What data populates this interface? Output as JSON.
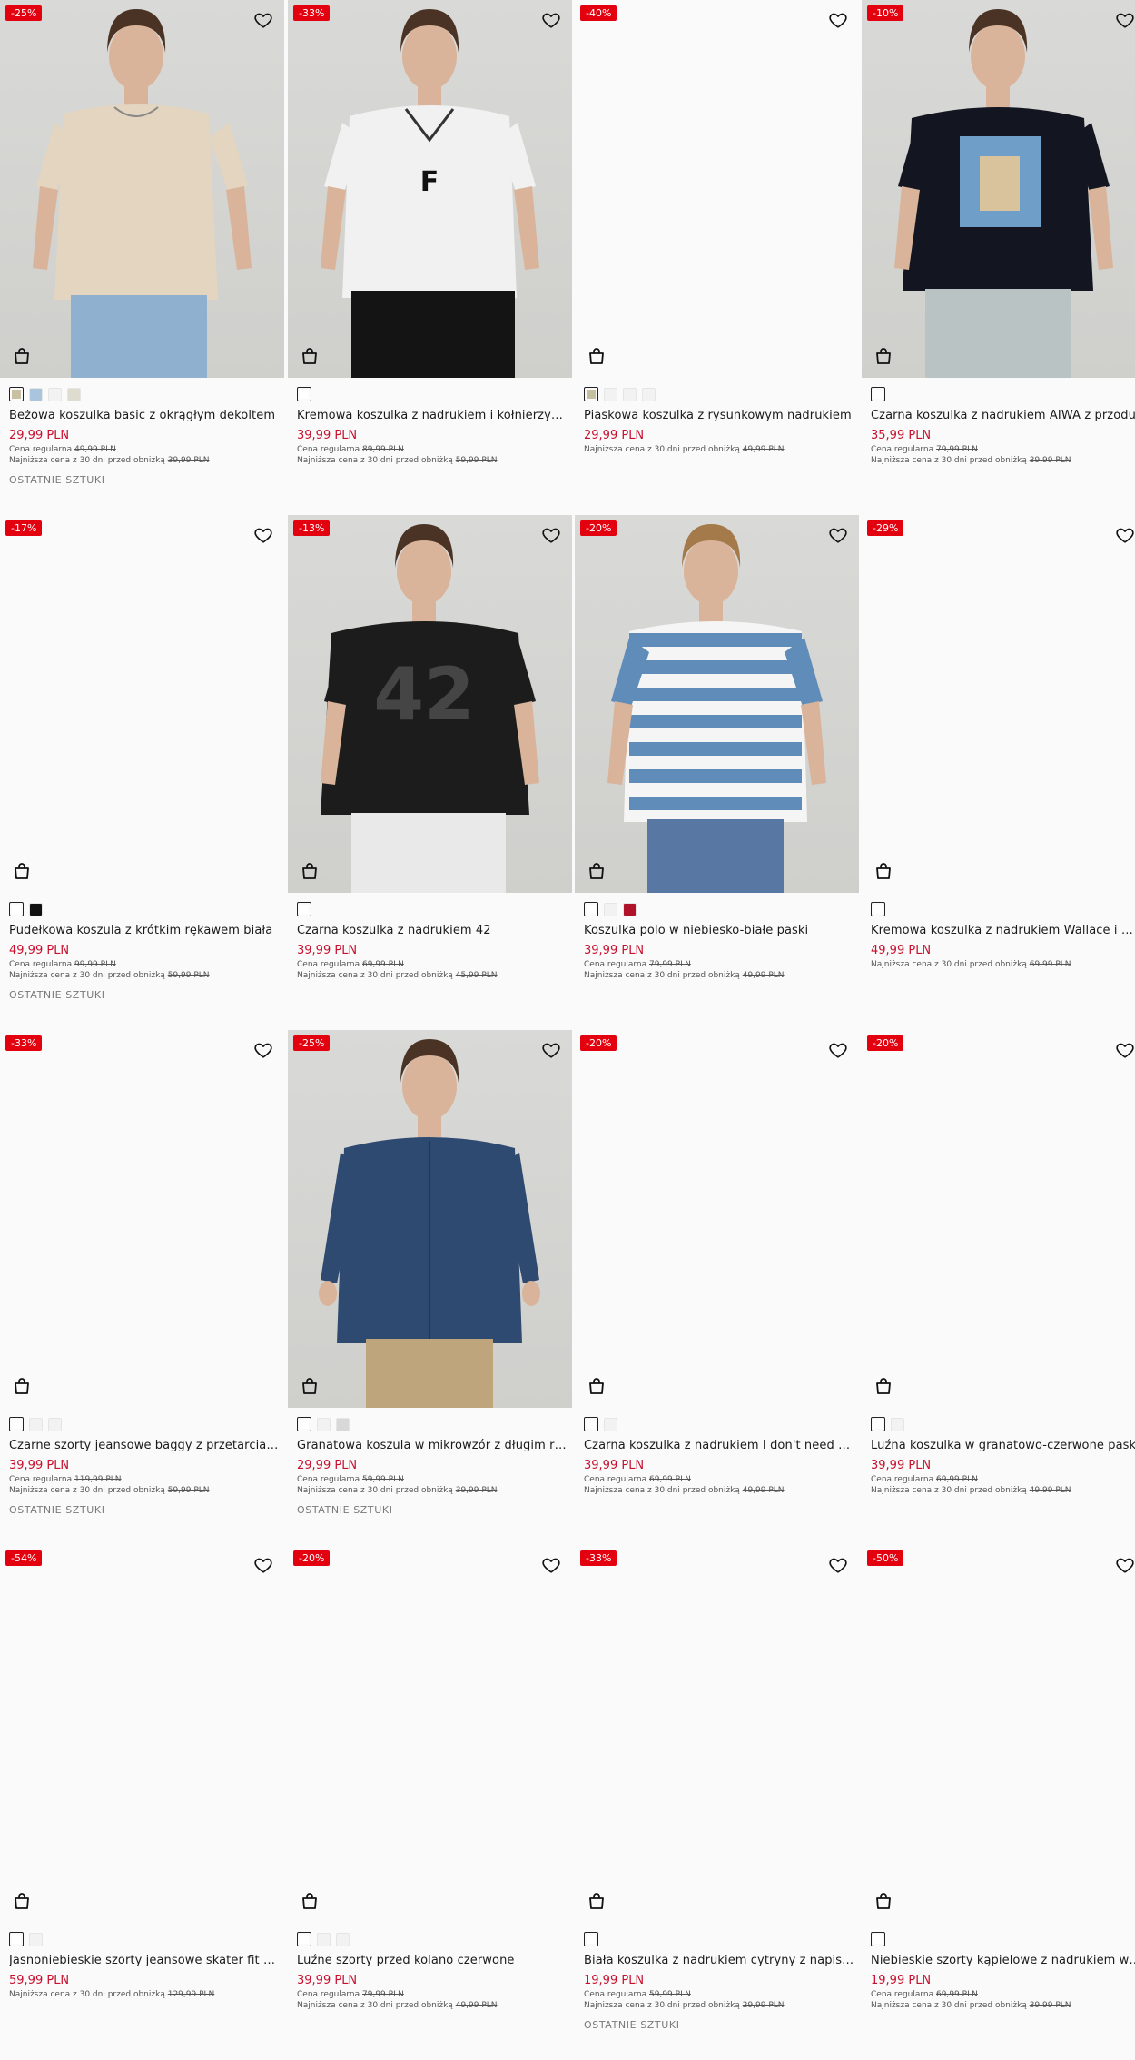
{
  "accent_color": "#e3000f",
  "price_color": "#c8102e",
  "labels": {
    "regular": "Cena regularna",
    "lowest": "Najniższa cena z 30 dni przed obniżką",
    "last_items": "OSTATNIE SZTUKI"
  },
  "products": [
    {
      "discount": "-25%",
      "name": "Beżowa koszulka basic z okrągłym dekoltem",
      "price": "29,99 PLN",
      "regular": "49,99 PLN",
      "lowest": "39,99 PLN",
      "last": true,
      "swatches": [
        "#c9bfa2",
        "#a9c4dd",
        "#f2f2f2",
        "#dedbcf"
      ],
      "model": "beige-tee"
    },
    {
      "discount": "-33%",
      "name": "Kremowa koszulka z nadrukiem i kołnierzykiem",
      "price": "39,99 PLN",
      "regular": "89,99 PLN",
      "lowest": "59,99 PLN",
      "last": false,
      "swatches": [
        "#ffffff"
      ],
      "model": "white-jersey"
    },
    {
      "discount": "-40%",
      "name": "Piaskowa koszulka z rysunkowym nadrukiem",
      "price": "29,99 PLN",
      "regular": "",
      "lowest": "49,99 PLN",
      "last": false,
      "swatches": [
        "#c3bfa0",
        "#f2f2f2",
        "#f2f2f2",
        "#f2f2f2"
      ],
      "model": "none"
    },
    {
      "discount": "-10%",
      "name": "Czarna koszulka z nadrukiem AIWA z przodu",
      "price": "35,99 PLN",
      "regular": "79,99 PLN",
      "lowest": "39,99 PLN",
      "last": false,
      "swatches": [
        "#ffffff"
      ],
      "model": "black-tee"
    },
    {
      "discount": "-17%",
      "name": "Pudełkowa koszula z krótkim rękawem biała",
      "price": "49,99 PLN",
      "regular": "99,99 PLN",
      "lowest": "59,99 PLN",
      "last": true,
      "swatches": [
        "#ffffff",
        "#111111"
      ],
      "model": "none"
    },
    {
      "discount": "-13%",
      "name": "Czarna koszulka z nadrukiem 42",
      "price": "39,99 PLN",
      "regular": "69,99 PLN",
      "lowest": "45,99 PLN",
      "last": false,
      "swatches": [
        "#ffffff"
      ],
      "model": "mesh-42"
    },
    {
      "discount": "-20%",
      "name": "Koszulka polo w niebiesko-białe paski",
      "price": "39,99 PLN",
      "regular": "79,99 PLN",
      "lowest": "49,99 PLN",
      "last": false,
      "swatches": [
        "#ffffff",
        "#f2f2f2",
        "#b0122a"
      ],
      "model": "polo-stripes"
    },
    {
      "discount": "-29%",
      "name": "Kremowa koszulka z nadrukiem Wallace i Gromit",
      "price": "49,99 PLN",
      "regular": "",
      "lowest": "69,99 PLN",
      "last": false,
      "swatches": [
        "#ffffff"
      ],
      "model": "none"
    },
    {
      "discount": "-33%",
      "name": "Czarne szorty jeansowe baggy z przetarciami",
      "price": "39,99 PLN",
      "regular": "119,99 PLN",
      "lowest": "59,99 PLN",
      "last": true,
      "swatches": [
        "#ffffff",
        "#f2f2f2",
        "#f2f2f2"
      ],
      "model": "none"
    },
    {
      "discount": "-25%",
      "name": "Granatowa koszula w mikrowzór z długim rękawem",
      "price": "29,99 PLN",
      "regular": "59,99 PLN",
      "lowest": "39,99 PLN",
      "last": true,
      "swatches": [
        "#ffffff",
        "#f2f2f2",
        "#d8d8d8"
      ],
      "model": "navy-shirt"
    },
    {
      "discount": "-20%",
      "name": "Czarna koszulka z nadrukiem I don't need Real Love",
      "price": "39,99 PLN",
      "regular": "69,99 PLN",
      "lowest": "49,99 PLN",
      "last": false,
      "swatches": [
        "#ffffff",
        "#f2f2f2"
      ],
      "model": "none"
    },
    {
      "discount": "-20%",
      "name": "Luźna koszulka w granatowo-czerwone paski",
      "price": "39,99 PLN",
      "regular": "69,99 PLN",
      "lowest": "49,99 PLN",
      "last": false,
      "swatches": [
        "#ffffff",
        "#f2f2f2"
      ],
      "model": "none"
    },
    {
      "discount": "-54%",
      "name": "Jasnoniebieskie szorty jeansowe skater fit z przetarciami",
      "price": "59,99 PLN",
      "regular": "",
      "lowest": "129,99 PLN",
      "last": false,
      "swatches": [
        "#ffffff",
        "#f2f2f2"
      ],
      "model": "none"
    },
    {
      "discount": "-20%",
      "name": "Luźne szorty przed kolano czerwone",
      "price": "39,99 PLN",
      "regular": "79,99 PLN",
      "lowest": "49,99 PLN",
      "last": false,
      "swatches": [
        "#ffffff",
        "#f2f2f2",
        "#f2f2f2"
      ],
      "model": "none"
    },
    {
      "discount": "-33%",
      "name": "Biała koszulka z nadrukiem cytryny z napisem",
      "price": "19,99 PLN",
      "regular": "59,99 PLN",
      "lowest": "29,99 PLN",
      "last": true,
      "swatches": [
        "#ffffff"
      ],
      "model": "none"
    },
    {
      "discount": "-50%",
      "name": "Niebieskie szorty kąpielowe z nadrukiem w palmy",
      "price": "19,99 PLN",
      "regular": "69,99 PLN",
      "lowest": "39,99 PLN",
      "last": false,
      "swatches": [
        "#ffffff"
      ],
      "model": "none"
    }
  ]
}
